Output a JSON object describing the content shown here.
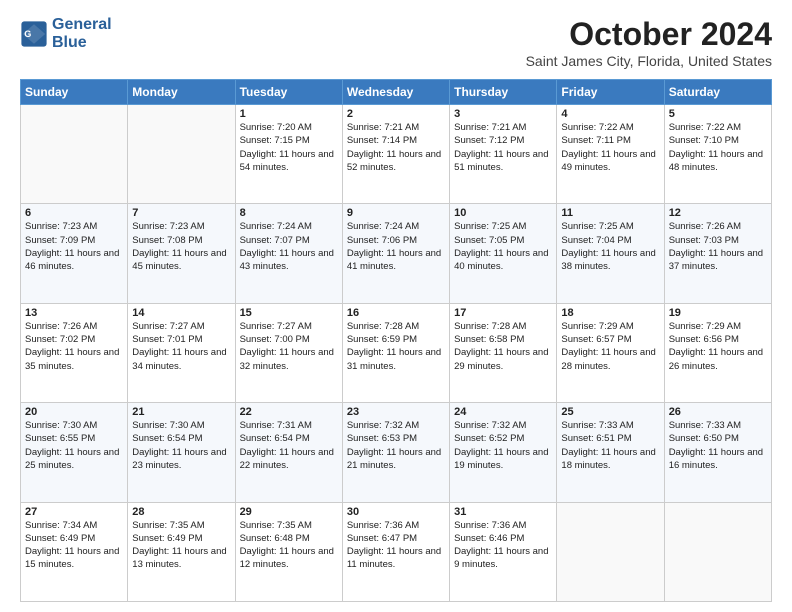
{
  "header": {
    "logo_line1": "General",
    "logo_line2": "Blue",
    "month": "October 2024",
    "location": "Saint James City, Florida, United States"
  },
  "weekdays": [
    "Sunday",
    "Monday",
    "Tuesday",
    "Wednesday",
    "Thursday",
    "Friday",
    "Saturday"
  ],
  "weeks": [
    [
      {
        "day": "",
        "info": ""
      },
      {
        "day": "",
        "info": ""
      },
      {
        "day": "1",
        "info": "Sunrise: 7:20 AM\nSunset: 7:15 PM\nDaylight: 11 hours and 54 minutes."
      },
      {
        "day": "2",
        "info": "Sunrise: 7:21 AM\nSunset: 7:14 PM\nDaylight: 11 hours and 52 minutes."
      },
      {
        "day": "3",
        "info": "Sunrise: 7:21 AM\nSunset: 7:12 PM\nDaylight: 11 hours and 51 minutes."
      },
      {
        "day": "4",
        "info": "Sunrise: 7:22 AM\nSunset: 7:11 PM\nDaylight: 11 hours and 49 minutes."
      },
      {
        "day": "5",
        "info": "Sunrise: 7:22 AM\nSunset: 7:10 PM\nDaylight: 11 hours and 48 minutes."
      }
    ],
    [
      {
        "day": "6",
        "info": "Sunrise: 7:23 AM\nSunset: 7:09 PM\nDaylight: 11 hours and 46 minutes."
      },
      {
        "day": "7",
        "info": "Sunrise: 7:23 AM\nSunset: 7:08 PM\nDaylight: 11 hours and 45 minutes."
      },
      {
        "day": "8",
        "info": "Sunrise: 7:24 AM\nSunset: 7:07 PM\nDaylight: 11 hours and 43 minutes."
      },
      {
        "day": "9",
        "info": "Sunrise: 7:24 AM\nSunset: 7:06 PM\nDaylight: 11 hours and 41 minutes."
      },
      {
        "day": "10",
        "info": "Sunrise: 7:25 AM\nSunset: 7:05 PM\nDaylight: 11 hours and 40 minutes."
      },
      {
        "day": "11",
        "info": "Sunrise: 7:25 AM\nSunset: 7:04 PM\nDaylight: 11 hours and 38 minutes."
      },
      {
        "day": "12",
        "info": "Sunrise: 7:26 AM\nSunset: 7:03 PM\nDaylight: 11 hours and 37 minutes."
      }
    ],
    [
      {
        "day": "13",
        "info": "Sunrise: 7:26 AM\nSunset: 7:02 PM\nDaylight: 11 hours and 35 minutes."
      },
      {
        "day": "14",
        "info": "Sunrise: 7:27 AM\nSunset: 7:01 PM\nDaylight: 11 hours and 34 minutes."
      },
      {
        "day": "15",
        "info": "Sunrise: 7:27 AM\nSunset: 7:00 PM\nDaylight: 11 hours and 32 minutes."
      },
      {
        "day": "16",
        "info": "Sunrise: 7:28 AM\nSunset: 6:59 PM\nDaylight: 11 hours and 31 minutes."
      },
      {
        "day": "17",
        "info": "Sunrise: 7:28 AM\nSunset: 6:58 PM\nDaylight: 11 hours and 29 minutes."
      },
      {
        "day": "18",
        "info": "Sunrise: 7:29 AM\nSunset: 6:57 PM\nDaylight: 11 hours and 28 minutes."
      },
      {
        "day": "19",
        "info": "Sunrise: 7:29 AM\nSunset: 6:56 PM\nDaylight: 11 hours and 26 minutes."
      }
    ],
    [
      {
        "day": "20",
        "info": "Sunrise: 7:30 AM\nSunset: 6:55 PM\nDaylight: 11 hours and 25 minutes."
      },
      {
        "day": "21",
        "info": "Sunrise: 7:30 AM\nSunset: 6:54 PM\nDaylight: 11 hours and 23 minutes."
      },
      {
        "day": "22",
        "info": "Sunrise: 7:31 AM\nSunset: 6:54 PM\nDaylight: 11 hours and 22 minutes."
      },
      {
        "day": "23",
        "info": "Sunrise: 7:32 AM\nSunset: 6:53 PM\nDaylight: 11 hours and 21 minutes."
      },
      {
        "day": "24",
        "info": "Sunrise: 7:32 AM\nSunset: 6:52 PM\nDaylight: 11 hours and 19 minutes."
      },
      {
        "day": "25",
        "info": "Sunrise: 7:33 AM\nSunset: 6:51 PM\nDaylight: 11 hours and 18 minutes."
      },
      {
        "day": "26",
        "info": "Sunrise: 7:33 AM\nSunset: 6:50 PM\nDaylight: 11 hours and 16 minutes."
      }
    ],
    [
      {
        "day": "27",
        "info": "Sunrise: 7:34 AM\nSunset: 6:49 PM\nDaylight: 11 hours and 15 minutes."
      },
      {
        "day": "28",
        "info": "Sunrise: 7:35 AM\nSunset: 6:49 PM\nDaylight: 11 hours and 13 minutes."
      },
      {
        "day": "29",
        "info": "Sunrise: 7:35 AM\nSunset: 6:48 PM\nDaylight: 11 hours and 12 minutes."
      },
      {
        "day": "30",
        "info": "Sunrise: 7:36 AM\nSunset: 6:47 PM\nDaylight: 11 hours and 11 minutes."
      },
      {
        "day": "31",
        "info": "Sunrise: 7:36 AM\nSunset: 6:46 PM\nDaylight: 11 hours and 9 minutes."
      },
      {
        "day": "",
        "info": ""
      },
      {
        "day": "",
        "info": ""
      }
    ]
  ]
}
